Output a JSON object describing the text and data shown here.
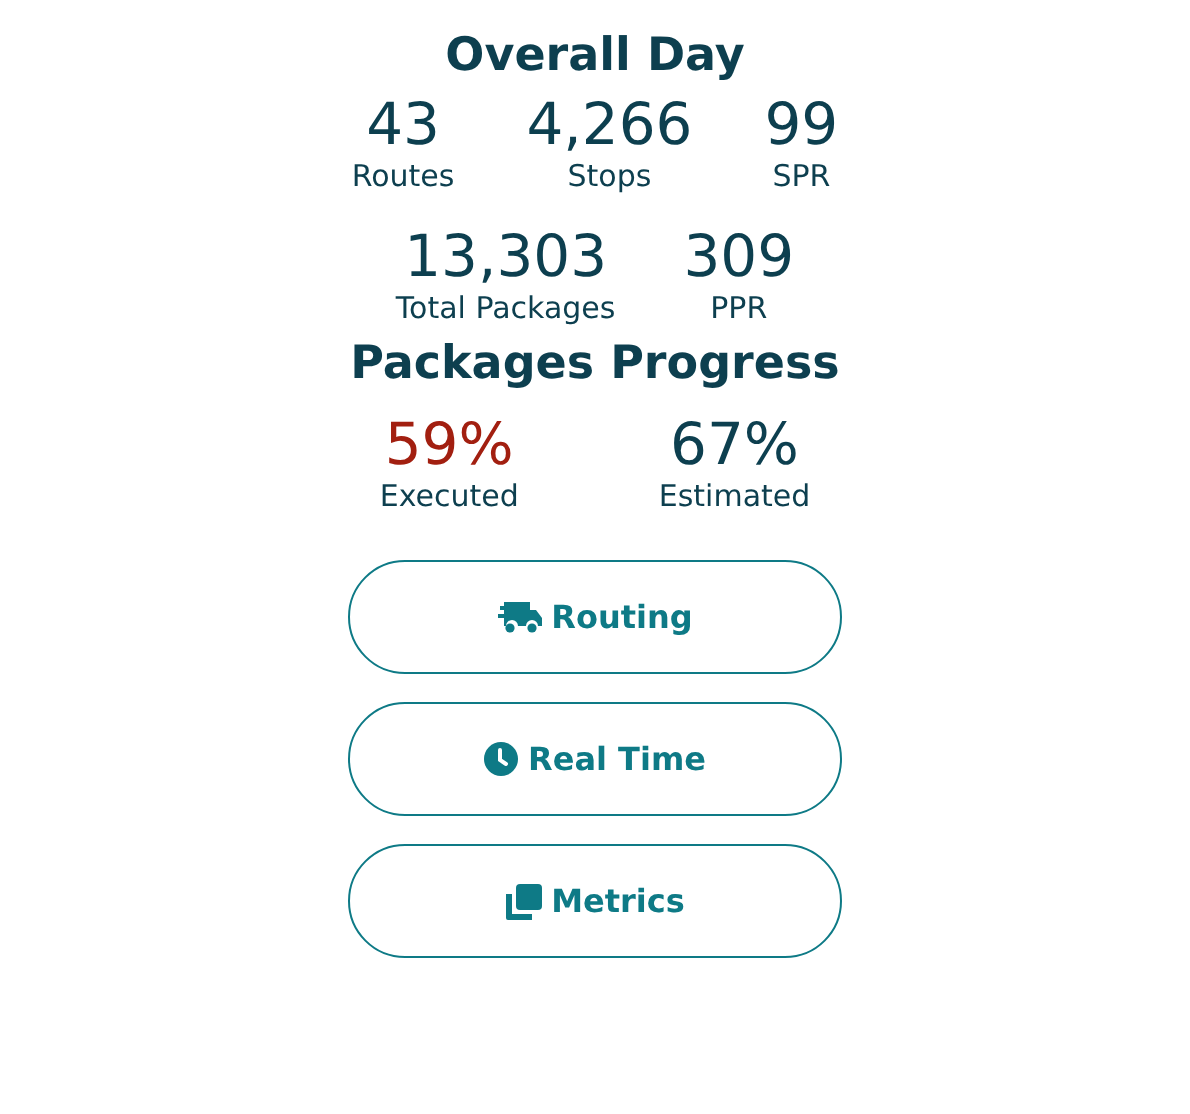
{
  "overall": {
    "title": "Overall Day",
    "row_1": [
      {
        "value": "43",
        "label": "Routes"
      },
      {
        "value": "4,266",
        "label": "Stops"
      },
      {
        "value": "99",
        "label": "SPR"
      }
    ],
    "row_2": [
      {
        "value": "13,303",
        "label": "Total Packages"
      },
      {
        "value": "309",
        "label": "PPR"
      }
    ]
  },
  "progress": {
    "title": "Packages Progress",
    "items": [
      {
        "value": "59%",
        "label": "Executed",
        "color": "#a21f10"
      },
      {
        "value": "67%",
        "label": "Estimated",
        "color": "#0d3f4f"
      }
    ]
  },
  "buttons": [
    {
      "label": "Routing",
      "kind": "truck"
    },
    {
      "label": "Real Time",
      "kind": "clock"
    },
    {
      "label": "Metrics",
      "kind": "copy"
    }
  ]
}
